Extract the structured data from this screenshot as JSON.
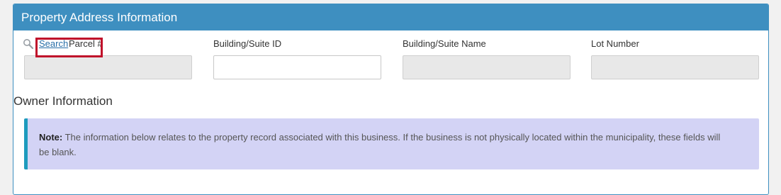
{
  "panel": {
    "title": "Property Address Information"
  },
  "fields": {
    "parcel": {
      "search_link": "Search",
      "label": "Parcel #",
      "value": ""
    },
    "building_suite_id": {
      "label": "Building/Suite ID",
      "value": ""
    },
    "building_suite_name": {
      "label": "Building/Suite Name",
      "value": ""
    },
    "lot_number": {
      "label": "Lot Number",
      "value": ""
    }
  },
  "owner_section": {
    "title": "Owner Information",
    "note_label": "Note:",
    "note_text": " The information below relates to the property record associated with this business. If the business is not physically located within the municipality, these fields will be blank."
  },
  "colors": {
    "header_blue": "#3e8fc0",
    "highlight_red": "#c0102a",
    "note_bg": "#d3d3f5",
    "note_border": "#1e9bbd",
    "link_blue": "#2a6fa8",
    "disabled_input": "#e8e8e8"
  },
  "icons": {
    "search": "magnifier-icon"
  }
}
